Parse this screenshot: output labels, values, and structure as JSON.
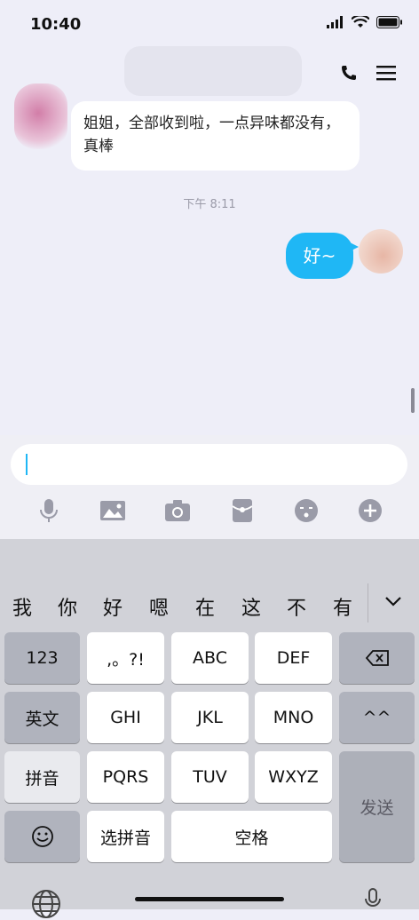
{
  "status": {
    "time": "10:40"
  },
  "chat": {
    "incoming": "姐姐，全部收到啦，一点异味都没有，真棒",
    "timestamp": "下午 8:11",
    "outgoing": "好~"
  },
  "keyboard": {
    "candidates": [
      "我",
      "你",
      "好",
      "嗯",
      "在",
      "这",
      "不",
      "有"
    ],
    "row1": [
      "123",
      ",。?!",
      "ABC",
      "DEF"
    ],
    "row2": [
      "英文",
      "GHI",
      "JKL",
      "MNO",
      "^^"
    ],
    "row3": [
      "拼音",
      "PQRS",
      "TUV",
      "WXYZ"
    ],
    "send": "发送",
    "row4_pinyin": "选拼音",
    "space": "空格"
  }
}
